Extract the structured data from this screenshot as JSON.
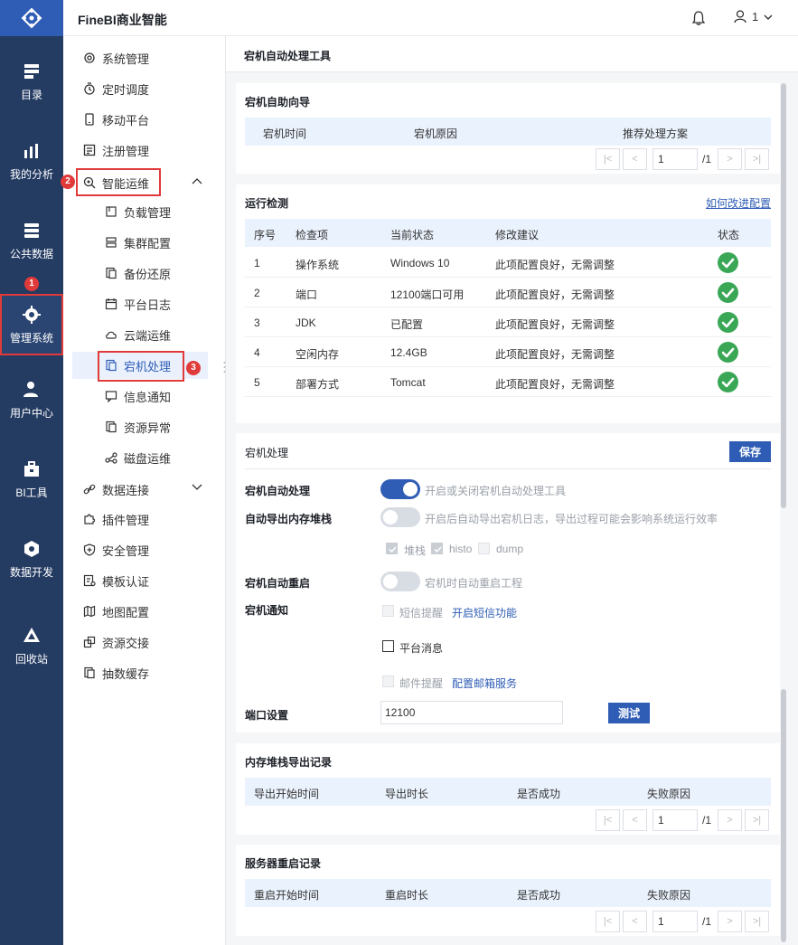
{
  "app": {
    "brand": "FineBI商业智能",
    "user_count": "1"
  },
  "leftnav": [
    {
      "label": "目录",
      "icon": "catalog-icon"
    },
    {
      "label": "我的分析",
      "icon": "analysis-icon"
    },
    {
      "label": "公共数据",
      "icon": "public-data-icon"
    },
    {
      "label": "管理系统",
      "icon": "gear-icon"
    },
    {
      "label": "用户中心",
      "icon": "user-center-icon"
    },
    {
      "label": "BI工具",
      "icon": "toolbox-icon"
    },
    {
      "label": "数据开发",
      "icon": "data-dev-icon"
    },
    {
      "label": "回收站",
      "icon": "recycle-icon"
    }
  ],
  "annotations": {
    "b1": "1",
    "b2": "2",
    "b3": "3"
  },
  "submenu": {
    "items": [
      {
        "label": "系统管理",
        "icon": "system-icon"
      },
      {
        "label": "定时调度",
        "icon": "timer-icon"
      },
      {
        "label": "移动平台",
        "icon": "mobile-icon"
      },
      {
        "label": "注册管理",
        "icon": "register-icon"
      },
      {
        "label": "智能运维",
        "icon": "ops-icon"
      }
    ],
    "children": [
      {
        "label": "负载管理"
      },
      {
        "label": "集群配置"
      },
      {
        "label": "备份还原"
      },
      {
        "label": "平台日志"
      },
      {
        "label": "云端运维"
      },
      {
        "label": "宕机处理"
      },
      {
        "label": "信息通知"
      },
      {
        "label": "资源异常"
      },
      {
        "label": "磁盘运维"
      }
    ],
    "more": [
      {
        "label": "数据连接"
      },
      {
        "label": "插件管理"
      },
      {
        "label": "安全管理"
      },
      {
        "label": "模板认证"
      },
      {
        "label": "地图配置"
      },
      {
        "label": "资源交接"
      },
      {
        "label": "抽数缓存"
      }
    ]
  },
  "main": {
    "title": "宕机自动处理工具",
    "wizard": {
      "title": "宕机自助向导",
      "columns": [
        "宕机时间",
        "宕机原因",
        "推荐处理方案"
      ],
      "page": "1",
      "total": "/1"
    },
    "check": {
      "title": "运行检测",
      "link": "如何改进配置",
      "columns": [
        "序号",
        "检查项",
        "当前状态",
        "修改建议",
        "状态"
      ],
      "rows": [
        {
          "no": "1",
          "item": "操作系统",
          "state": "Windows 10",
          "advice": "此项配置良好，无需调整"
        },
        {
          "no": "2",
          "item": "端口",
          "state": "12100端口可用",
          "advice": "此项配置良好，无需调整"
        },
        {
          "no": "3",
          "item": "JDK",
          "state": "已配置",
          "advice": "此项配置良好，无需调整"
        },
        {
          "no": "4",
          "item": "空闲内存",
          "state": "12.4GB",
          "advice": "此项配置良好，无需调整"
        },
        {
          "no": "5",
          "item": "部署方式",
          "state": "Tomcat",
          "advice": "此项配置良好，无需调整"
        }
      ]
    },
    "handling": {
      "title": "宕机处理",
      "save": "保存",
      "auto_handle_label": "宕机自动处理",
      "auto_handle_hint": "开启或关闭宕机自动处理工具",
      "auto_handle_on": true,
      "dump_label": "自动导出内存堆栈",
      "dump_hint": "开启后自动导出宕机日志，导出过程可能会影响系统运行效率",
      "dump_on": false,
      "dump_opts": [
        "堆栈",
        "histo",
        "dump"
      ],
      "restart_label": "宕机自动重启",
      "restart_hint": "宕机时自动重启工程",
      "restart_on": false,
      "notify_label": "宕机通知",
      "sms_label": "短信提醒",
      "sms_link": "开启短信功能",
      "platform_label": "平台消息",
      "mail_label": "邮件提醒",
      "mail_link": "配置邮箱服务",
      "port_label": "端口设置",
      "port_value": "12100",
      "test": "测试"
    },
    "dump_records": {
      "title": "内存堆栈导出记录",
      "columns": [
        "导出开始时间",
        "导出时长",
        "是否成功",
        "失败原因"
      ],
      "page": "1",
      "total": "/1"
    },
    "restart_records": {
      "title": "服务器重启记录",
      "columns": [
        "重启开始时间",
        "重启时长",
        "是否成功",
        "失败原因"
      ],
      "page": "1",
      "total": "/1"
    }
  },
  "colors": {
    "accent": "#2f5db5",
    "nav_bg": "#243b62",
    "highlight": "#e03a3a",
    "ok": "#3aa757"
  }
}
